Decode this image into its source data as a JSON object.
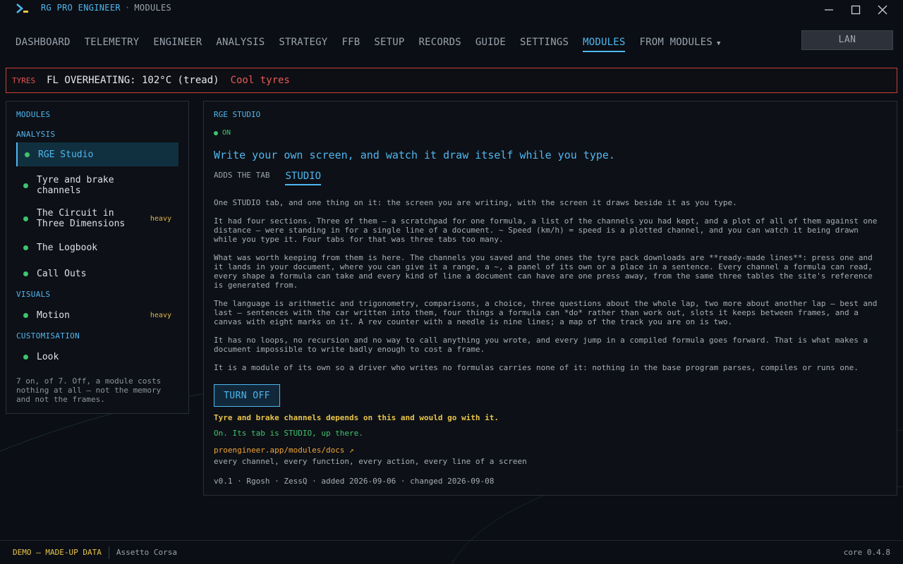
{
  "app": {
    "title": "RG PRO ENGINEER",
    "separator": "·",
    "section": "MODULES"
  },
  "nav": {
    "items": [
      "DASHBOARD",
      "TELEMETRY",
      "ENGINEER",
      "ANALYSIS",
      "STRATEGY",
      "FFB",
      "SETUP",
      "RECORDS",
      "GUIDE",
      "SETTINGS",
      "MODULES"
    ],
    "active": "MODULES",
    "dropdown": "FROM MODULES",
    "lan": "LAN"
  },
  "alert": {
    "tag": "TYRES",
    "message": "FL OVERHEATING: 102°C (tread)",
    "hint": "Cool tyres"
  },
  "sidebar": {
    "title": "MODULES",
    "groups": [
      {
        "heading": "ANALYSIS"
      },
      {
        "heading": "VISUALS"
      },
      {
        "heading": "CUSTOMISATION"
      }
    ],
    "items": [
      {
        "label": "RGE Studio",
        "badge": ""
      },
      {
        "label": "Tyre and brake channels",
        "badge": ""
      },
      {
        "label": "The Circuit in Three Dimensions",
        "badge": "heavy"
      },
      {
        "label": "The Logbook",
        "badge": ""
      },
      {
        "label": "Call Outs",
        "badge": ""
      },
      {
        "label": "Motion",
        "badge": "heavy"
      },
      {
        "label": "Look",
        "badge": ""
      }
    ],
    "footer": "7 on, of 7. Off, a module costs nothing at all — not the memory and not the frames."
  },
  "panel": {
    "title": "RGE STUDIO",
    "status": "ON",
    "headline": "Write your own screen, and watch it draw itself while you type.",
    "adds_label": "ADDS THE TAB",
    "tab": "STUDIO",
    "paragraphs": [
      "One STUDIO tab, and one thing on it: the screen you are writing, with the screen it draws beside it as you type.",
      "It had four sections. Three of them — a scratchpad for one formula, a list of the channels you had kept, and a plot of all of them against one distance — were standing in for a single line of a document. ~ Speed (km/h) = speed is a plotted channel, and you can watch it being drawn while you type it. Four tabs for that was three tabs too many.",
      "What was worth keeping from them is here. The channels you saved and the ones the tyre pack downloads are **ready-made lines**: press one and it lands in your document, where you can give it a range, a ~, a panel of its own or a place in a sentence. Every channel a formula can read, every shape a formula can take and every kind of line a document can have are one press away, from the same three tables the site's reference is generated from.",
      "The language is arithmetic and trigonometry, comparisons, a choice, three questions about the whole lap, two more about another lap — best and last — sentences with the car written into them, four things a formula can *do* rather than work out, slots it keeps between frames, and a canvas with eight marks on it. A rev counter with a needle is nine lines; a map of the track you are on is two.",
      "It has no loops, no recursion and no way to call anything you wrote, and every jump in a compiled formula goes forward. That is what makes a document impossible to write badly enough to cost a frame.",
      "It is a module of its own so a driver who writes no formulas carries none of it: nothing in the base program parses, compiles or runs one."
    ],
    "button": "TURN OFF",
    "dependency": "Tyre and brake channels depends on this and would go with it.",
    "state": "On. Its tab is STUDIO, up there.",
    "link": "proengineer.app/modules/docs ↗",
    "link_desc": "every channel, every function, every action, every line of a screen",
    "meta": "v0.1 · Rgosh · ZessQ · added 2026-09-06 · changed 2026-09-08"
  },
  "statusbar": {
    "demo": "DEMO — MADE-UP DATA",
    "game": "Assetto Corsa",
    "core": "core 0.4.8"
  },
  "colors": {
    "accent": "#4fb7f0",
    "ok": "#3ec46d",
    "warn": "#e8c44a",
    "alert": "#e05252",
    "link": "#f0a53a"
  },
  "icons": {
    "logo": "terminal-prompt-icon",
    "minimize": "minimize-icon",
    "maximize": "maximize-icon",
    "close": "close-icon",
    "dropdown": "chevron-down-icon",
    "external": "external-link-icon"
  }
}
